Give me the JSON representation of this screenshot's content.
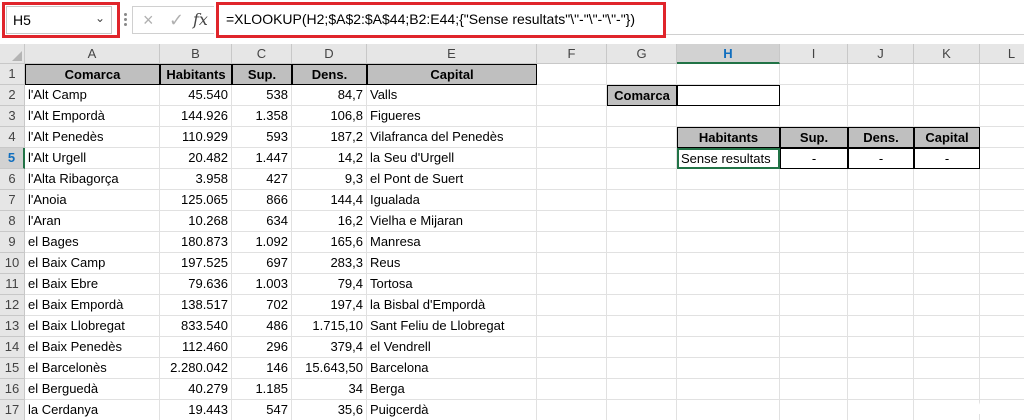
{
  "namebox": {
    "value": "H5"
  },
  "formula": "=XLOOKUP(H2;$A$2:$A$44;B2:E44;{\"Sense resultats\"\\\"-\"\\\"-\"\\\"-\"})",
  "icons": {
    "cancel": "×",
    "enter": "✓",
    "fx": "fx"
  },
  "columns": [
    "A",
    "B",
    "C",
    "D",
    "E",
    "F",
    "G",
    "H",
    "I",
    "J",
    "K",
    "L"
  ],
  "rows": [
    "1",
    "2",
    "3",
    "4",
    "5",
    "6",
    "7",
    "8",
    "9",
    "10",
    "11",
    "12",
    "13",
    "14",
    "15",
    "16",
    "17"
  ],
  "table": {
    "headers": [
      "Comarca",
      "Habitants",
      "Sup.",
      "Dens.",
      "Capital"
    ],
    "data": [
      [
        "l'Alt Camp",
        "45.540",
        "538",
        "84,7",
        "Valls"
      ],
      [
        "l'Alt Empordà",
        "144.926",
        "1.358",
        "106,8",
        "Figueres"
      ],
      [
        "l'Alt Penedès",
        "110.929",
        "593",
        "187,2",
        "Vilafranca del Penedès"
      ],
      [
        "l'Alt Urgell",
        "20.482",
        "1.447",
        "14,2",
        "la Seu d'Urgell"
      ],
      [
        "l'Alta Ribagorça",
        "3.958",
        "427",
        "9,3",
        "el Pont de Suert"
      ],
      [
        "l'Anoia",
        "125.065",
        "866",
        "144,4",
        "Igualada"
      ],
      [
        "l'Aran",
        "10.268",
        "634",
        "16,2",
        "Vielha e Mijaran"
      ],
      [
        "el Bages",
        "180.873",
        "1.092",
        "165,6",
        "Manresa"
      ],
      [
        "el Baix Camp",
        "197.525",
        "697",
        "283,3",
        "Reus"
      ],
      [
        "el Baix Ebre",
        "79.636",
        "1.003",
        "79,4",
        "Tortosa"
      ],
      [
        "el Baix Empordà",
        "138.517",
        "702",
        "197,4",
        "la Bisbal d'Empordà"
      ],
      [
        "el Baix Llobregat",
        "833.540",
        "486",
        "1.715,10",
        "Sant Feliu de Llobregat"
      ],
      [
        "el Baix Penedès",
        "112.460",
        "296",
        "379,4",
        "el Vendrell"
      ],
      [
        "el Barcelonès",
        "2.280.042",
        "146",
        "15.643,50",
        "Barcelona"
      ],
      [
        "el Berguedà",
        "40.279",
        "1.185",
        "34",
        "Berga"
      ],
      [
        "la Cerdanya",
        "19.443",
        "547",
        "35,6",
        "Puigcerdà"
      ]
    ]
  },
  "lookup": {
    "label": "Comarca",
    "input": "",
    "result_headers": [
      "Habitants",
      "Sup.",
      "Dens.",
      "Capital"
    ],
    "result_values": [
      "Sense resultats",
      "-",
      "-",
      "-"
    ]
  }
}
